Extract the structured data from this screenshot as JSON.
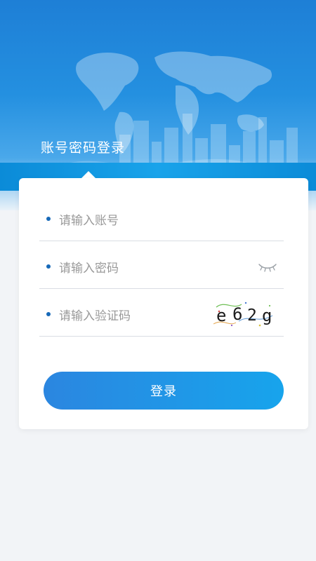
{
  "header": {
    "title": "账号密码登录"
  },
  "form": {
    "account": {
      "placeholder": "请输入账号",
      "value": ""
    },
    "password": {
      "placeholder": "请输入密码",
      "value": ""
    },
    "captcha": {
      "placeholder": "请输入验证码",
      "value": "",
      "code": "e62g"
    },
    "submit_label": "登录"
  },
  "icons": {
    "bullet": "dot-icon",
    "password_toggle": "eye-closed-icon",
    "captcha": "captcha-image"
  },
  "colors": {
    "accent": "#1e88e5",
    "bullet": "#1769b8",
    "button_start": "#2b86e0",
    "button_end": "#17a4ec"
  }
}
